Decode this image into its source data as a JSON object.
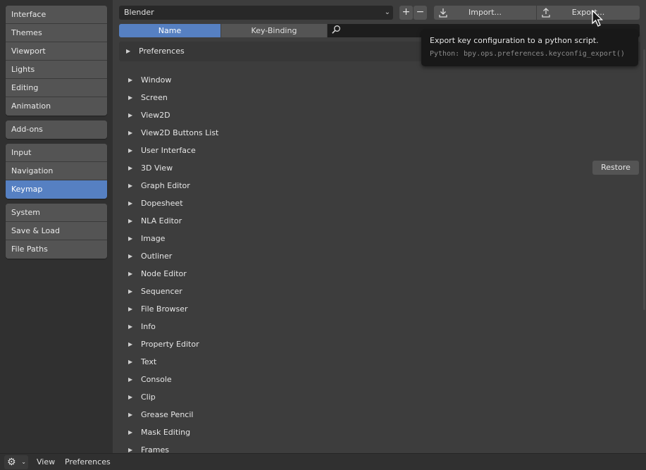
{
  "sidebar": {
    "groups": [
      {
        "items": [
          {
            "label": "Interface"
          },
          {
            "label": "Themes"
          },
          {
            "label": "Viewport"
          },
          {
            "label": "Lights"
          },
          {
            "label": "Editing"
          },
          {
            "label": "Animation"
          }
        ]
      },
      {
        "items": [
          {
            "label": "Add-ons"
          }
        ]
      },
      {
        "items": [
          {
            "label": "Input"
          },
          {
            "label": "Navigation"
          },
          {
            "label": "Keymap",
            "active": true
          }
        ]
      },
      {
        "items": [
          {
            "label": "System"
          },
          {
            "label": "Save & Load"
          },
          {
            "label": "File Paths"
          }
        ]
      }
    ]
  },
  "toolbar": {
    "preset_value": "Blender",
    "add_label": "+",
    "remove_label": "−",
    "import_label": "Import...",
    "export_label": "Export..."
  },
  "tabs": {
    "name_label": "Name",
    "keybinding_label": "Key-Binding",
    "active": "name"
  },
  "search": {
    "placeholder": "",
    "value": ""
  },
  "preferences_panel": {
    "label": "Preferences",
    "expanded": false
  },
  "keymap": {
    "items": [
      {
        "label": "Window"
      },
      {
        "label": "Screen"
      },
      {
        "label": "View2D"
      },
      {
        "label": "View2D Buttons List"
      },
      {
        "label": "User Interface"
      },
      {
        "label": "3D View"
      },
      {
        "label": "Graph Editor"
      },
      {
        "label": "Dopesheet"
      },
      {
        "label": "NLA Editor"
      },
      {
        "label": "Image"
      },
      {
        "label": "Outliner"
      },
      {
        "label": "Node Editor"
      },
      {
        "label": "Sequencer"
      },
      {
        "label": "File Browser"
      },
      {
        "label": "Info"
      },
      {
        "label": "Property Editor"
      },
      {
        "label": "Text"
      },
      {
        "label": "Console"
      },
      {
        "label": "Clip"
      },
      {
        "label": "Grease Pencil"
      },
      {
        "label": "Mask Editing"
      },
      {
        "label": "Frames"
      }
    ],
    "restore_label": "Restore"
  },
  "tooltip": {
    "description": "Export key configuration to a python script.",
    "python": "Python: bpy.ops.preferences.keyconfig_export()"
  },
  "statusbar": {
    "menus": [
      {
        "label": "View"
      },
      {
        "label": "Preferences"
      }
    ]
  },
  "icons": {
    "gear": "gear-icon",
    "import": "import-icon",
    "export": "export-icon",
    "search": "search-icon",
    "disclosure": "triangle-right-icon"
  },
  "colors": {
    "accent": "#5680c2",
    "button": "#545454",
    "panel_bg": "#3d3d3d",
    "sidebar_bg": "#303030",
    "tooltip_bg": "#181818"
  }
}
